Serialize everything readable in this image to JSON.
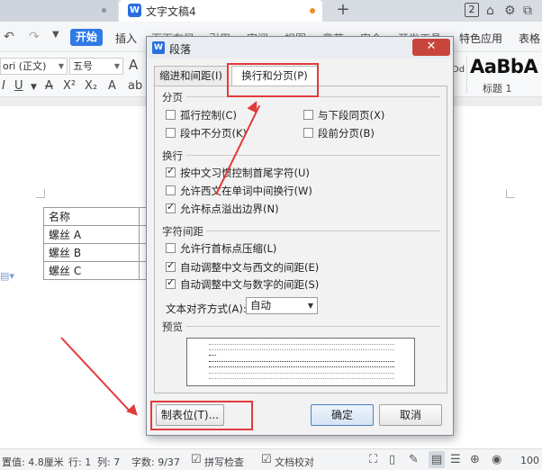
{
  "tabbar": {
    "doc_title": "文字文稿4",
    "new_tab_symbol": "+",
    "tab_count": "2",
    "icons": [
      "skin-icon",
      "settings-icon",
      "window-icon"
    ]
  },
  "menubar": {
    "undo": "↶",
    "redo": "↷",
    "start": "开始",
    "items": [
      "插入",
      "页面布局",
      "引用",
      "审阅",
      "视图",
      "章节",
      "安全",
      "开发工具",
      "特色应用",
      "表格"
    ]
  },
  "ribbon": {
    "font_name": "ori (正文)",
    "font_size": "五号",
    "style_sample": "AaBbA",
    "style_name": "标题 1",
    "style_prev": "Dd"
  },
  "document": {
    "table_rows": [
      "名称",
      "螺丝 A",
      "螺丝 B",
      "螺丝 C"
    ]
  },
  "statusbar": {
    "position": "置值: 4.8厘米",
    "row": "行: 1",
    "column": "列: 7",
    "wordcount": "字数: 9/37",
    "spellcheck": "拼写检查",
    "doc_check": "文档校对",
    "zoom": "100"
  },
  "dialog": {
    "title": "段落",
    "tabs": [
      {
        "label": "缩进和间距(I)",
        "active": false
      },
      {
        "label": "换行和分页(P)",
        "active": true
      }
    ],
    "groups": {
      "pagination": "分页",
      "line_break": "换行",
      "char_spacing": "字符间距",
      "preview": "预览"
    },
    "pagination_options": [
      {
        "label": "孤行控制(C)",
        "checked": false
      },
      {
        "label": "与下段同页(X)",
        "checked": false
      },
      {
        "label": "段中不分页(K)",
        "checked": false
      },
      {
        "label": "段前分页(B)",
        "checked": false
      }
    ],
    "line_break_options": [
      {
        "label": "按中文习惯控制首尾字符(U)",
        "checked": true
      },
      {
        "label": "允许西文在单词中间换行(W)",
        "checked": false
      },
      {
        "label": "允许标点溢出边界(N)",
        "checked": true
      }
    ],
    "char_spacing_options": [
      {
        "label": "允许行首标点压缩(L)",
        "checked": false
      },
      {
        "label": "自动调整中文与西文的间距(E)",
        "checked": true
      },
      {
        "label": "自动调整中文与数字的间距(S)",
        "checked": true
      }
    ],
    "text_alignment": {
      "label": "文本对齐方式(A):",
      "value": "自动"
    },
    "buttons": {
      "tabs": "制表位(T)...",
      "ok": "确定",
      "cancel": "取消"
    }
  },
  "annotation_color": "#e23b3b"
}
